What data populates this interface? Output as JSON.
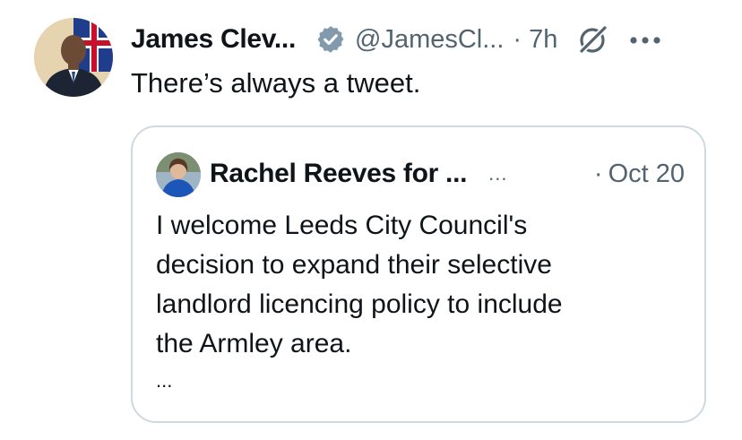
{
  "tweet": {
    "author_name": "James Clev...",
    "handle": "@JamesCl...",
    "separator": "·",
    "time": "7h",
    "text": "There’s always a tweet.",
    "icons": {
      "avatar": "james-cleverly-avatar",
      "verified": "verified-badge-icon",
      "grok": "grok-icon",
      "more": "more-options-icon"
    }
  },
  "quoted_tweet": {
    "author_name": "Rachel Reeves for ...",
    "handle": "...",
    "separator": "·",
    "date": "Oct 20",
    "text_lines": [
      "I welcome Leeds City Council's",
      "decision to expand their selective",
      "landlord licencing policy to include",
      "the Armley area."
    ],
    "truncation": "..."
  },
  "colors": {
    "text_primary": "#0f1419",
    "text_secondary": "#536471",
    "card_border": "#cfd9de",
    "verified_badge": "#829aab"
  }
}
